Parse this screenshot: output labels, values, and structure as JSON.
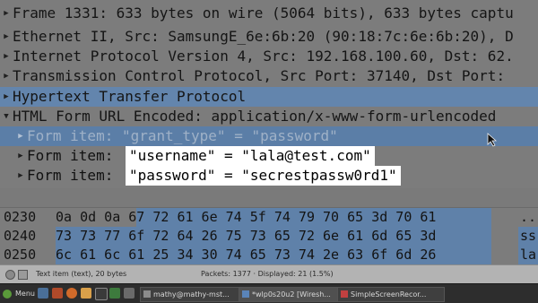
{
  "packet_tree": {
    "rows": [
      {
        "text": "Frame 1331: 633 bytes on wire (5064 bits), 633 bytes captu"
      },
      {
        "text": "Ethernet II, Src: SamsungE_6e:6b:20 (90:18:7c:6e:6b:20), D"
      },
      {
        "text": "Internet Protocol Version 4, Src: 192.168.100.60, Dst: 62."
      },
      {
        "text": "Transmission Control Protocol, Src Port: 37140, Dst Port:"
      },
      {
        "text": "Hypertext Transfer Protocol"
      },
      {
        "text": "HTML Form URL Encoded: application/x-www-form-urlencoded"
      },
      {
        "text": "Form item: \"grant_type\" = \"password\""
      },
      {
        "label": "Form item:",
        "value": "\"username\" = \"lala@test.com\""
      },
      {
        "label": "Form item:",
        "value": "\"password\" = \"secrestpassw0rd1\""
      }
    ]
  },
  "hex_pane": {
    "rows": [
      {
        "offset": "0230",
        "bytes": "0a 0d 0a 67 72 61 6e 74  5f 74 79 70 65 3d 70 61",
        "ascii": "..."
      },
      {
        "offset": "0240",
        "bytes": "73 73 77 6f 72 64 26 75  73 65 72 6e 61 6d 65 3d",
        "ascii": "ss"
      },
      {
        "offset": "0250",
        "bytes": "6c 61 6c 61 25 34 30 74  65 73 74 2e 63 6f 6d 26",
        "ascii": "la"
      }
    ]
  },
  "status_bar": {
    "field_info": "Text item (text), 20 bytes",
    "packets_info": "Packets: 1377 · Displayed: 21 (1.5%)"
  },
  "taskbar": {
    "menu_label": "Menu",
    "tasks": [
      {
        "label": "mathy@mathy-mst..."
      },
      {
        "label": "*wlp0s20u2 [Wiresh..."
      },
      {
        "label": "SimpleScreenRecor..."
      }
    ]
  }
}
